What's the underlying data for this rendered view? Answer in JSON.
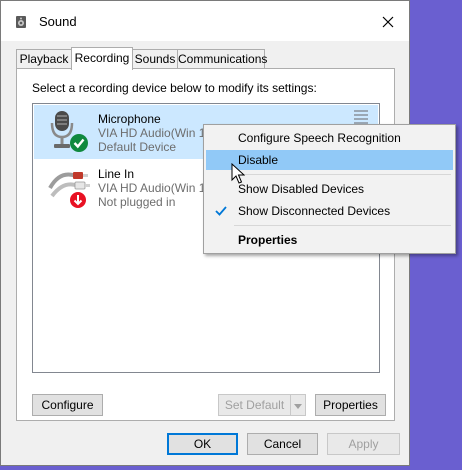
{
  "window": {
    "title": "Sound"
  },
  "tabs": [
    {
      "label": "Playback"
    },
    {
      "label": "Recording"
    },
    {
      "label": "Sounds"
    },
    {
      "label": "Communications"
    }
  ],
  "instruction": "Select a recording device below to modify its settings:",
  "devices": [
    {
      "name": "Microphone",
      "line1": "VIA HD Audio(Win 10",
      "line2": "Default Device",
      "status_icon": "green-check-icon"
    },
    {
      "name": "Line In",
      "line1": "VIA HD Audio(Win 10",
      "line2": "Not plugged in",
      "status_icon": "red-down-arrow-icon"
    }
  ],
  "context_menu": {
    "items": [
      {
        "label": "Configure Speech Recognition"
      },
      {
        "label": "Disable"
      },
      {
        "label": "Show Disabled Devices"
      },
      {
        "label": "Show Disconnected Devices",
        "checked": true
      },
      {
        "label": "Properties"
      }
    ]
  },
  "buttons": {
    "configure": "Configure",
    "set_default": "Set Default",
    "properties": "Properties",
    "ok": "OK",
    "cancel": "Cancel",
    "apply": "Apply"
  },
  "colors": {
    "desktop": "#6a5fd0",
    "selection": "#cce8ff",
    "menu_highlight": "#91c9f7",
    "default_button_border": "#0078d7"
  }
}
